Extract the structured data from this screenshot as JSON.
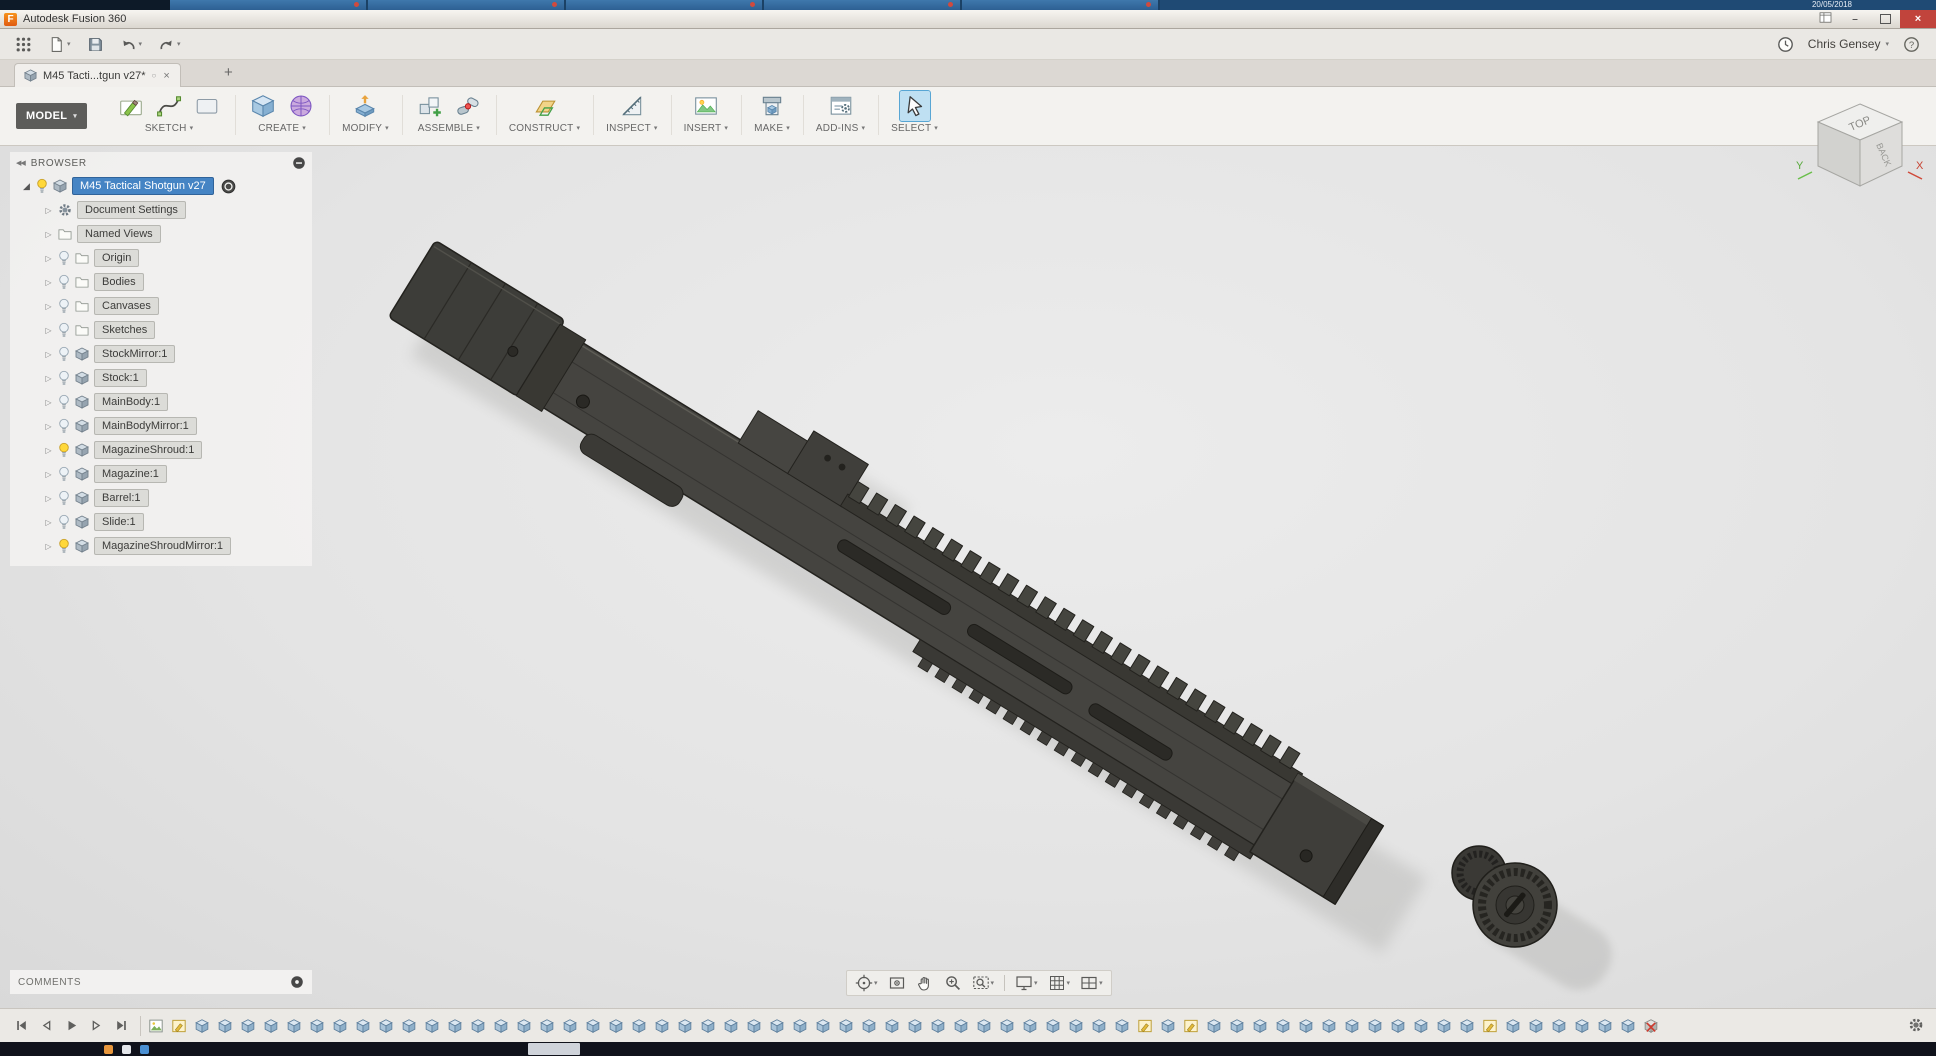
{
  "glyphs": {
    "caret": "▾",
    "plus": "+",
    "close": "×",
    "minimize": "–",
    "status_circle": "○",
    "collapse": "◀◀",
    "expander": "▷",
    "expander_open": "◢"
  },
  "chrome_strip": {
    "tab_count": 5,
    "date": "20/05/2018"
  },
  "titlebar": {
    "app_initial": "F",
    "title": "Autodesk Fusion 360"
  },
  "qat": {
    "buttons": [
      {
        "icon": "app-grid-icon",
        "caret": false
      },
      {
        "icon": "file-icon",
        "caret": true
      },
      {
        "icon": "save-icon",
        "caret": false
      },
      {
        "icon": "undo-icon",
        "caret": true
      },
      {
        "icon": "redo-icon",
        "caret": true
      }
    ],
    "user": "Chris Gensey"
  },
  "doc_tab": {
    "label": "M45 Tacti...tgun v27*"
  },
  "ribbon": {
    "mode_label": "MODEL",
    "groups": [
      {
        "label": "SKETCH",
        "icons": [
          "create-sketch-icon",
          "spline-icon",
          "rectangle-icon"
        ],
        "active": false
      },
      {
        "label": "CREATE",
        "icons": [
          "solid-box-icon",
          "form-sphere-icon"
        ],
        "active": false
      },
      {
        "label": "MODIFY",
        "icons": [
          "press-pull-icon"
        ],
        "active": false
      },
      {
        "label": "ASSEMBLE",
        "icons": [
          "new-component-icon",
          "joint-icon"
        ],
        "active": false
      },
      {
        "label": "CONSTRUCT",
        "icons": [
          "construct-plane-icon"
        ],
        "active": false
      },
      {
        "label": "INSPECT",
        "icons": [
          "measure-icon"
        ],
        "active": false
      },
      {
        "label": "INSERT",
        "icons": [
          "insert-canvas-icon"
        ],
        "active": false
      },
      {
        "label": "MAKE",
        "icons": [
          "make-3dprint-icon"
        ],
        "active": false
      },
      {
        "label": "ADD-INS",
        "icons": [
          "addins-scripts-icon"
        ],
        "active": false
      },
      {
        "label": "SELECT",
        "icons": [
          "select-cursor-icon"
        ],
        "active": true
      }
    ]
  },
  "viewcube": {
    "top_face": "TOP",
    "right_face": "BACK",
    "axis_x": "X",
    "axis_y": "Y"
  },
  "browser": {
    "header": "BROWSER",
    "root": {
      "label": "M45 Tactical Shotgun v27",
      "bulb": "on"
    },
    "items": [
      {
        "label": "Document Settings",
        "icon": "gear",
        "bulb": null
      },
      {
        "label": "Named Views",
        "icon": "folder",
        "bulb": null
      },
      {
        "label": "Origin",
        "icon": "folder",
        "bulb": "off"
      },
      {
        "label": "Bodies",
        "icon": "folder",
        "bulb": "off"
      },
      {
        "label": "Canvases",
        "icon": "folder",
        "bulb": "off"
      },
      {
        "label": "Sketches",
        "icon": "folder",
        "bulb": "off"
      },
      {
        "label": "StockMirror:1",
        "icon": "component",
        "bulb": "off"
      },
      {
        "label": "Stock:1",
        "icon": "component",
        "bulb": "off"
      },
      {
        "label": "MainBody:1",
        "icon": "component",
        "bulb": "off"
      },
      {
        "label": "MainBodyMirror:1",
        "icon": "component",
        "bulb": "off"
      },
      {
        "label": "MagazineShroud:1",
        "icon": "component",
        "bulb": "on"
      },
      {
        "label": "Magazine:1",
        "icon": "component",
        "bulb": "off"
      },
      {
        "label": "Barrel:1",
        "icon": "component",
        "bulb": "off"
      },
      {
        "label": "Slide:1",
        "icon": "component",
        "bulb": "off"
      },
      {
        "label": "MagazineShroudMirror:1",
        "icon": "component",
        "bulb": "on"
      }
    ]
  },
  "comments": {
    "label": "COMMENTS"
  },
  "navbar": {
    "buttons": [
      {
        "icon": "orbit-icon",
        "caret": true,
        "separator_before": false
      },
      {
        "icon": "look-at-icon",
        "caret": false,
        "separator_before": false
      },
      {
        "icon": "pan-icon",
        "caret": false,
        "separator_before": false
      },
      {
        "icon": "zoom-icon",
        "caret": false,
        "separator_before": false
      },
      {
        "icon": "zoom-window-icon",
        "caret": true,
        "separator_before": false
      },
      {
        "icon": "display-settings-icon",
        "caret": true,
        "separator_before": true
      },
      {
        "icon": "grid-settings-icon",
        "caret": true,
        "separator_before": false
      },
      {
        "icon": "viewport-settings-icon",
        "caret": true,
        "separator_before": false
      }
    ]
  },
  "timeline": {
    "playback": [
      "skip-start",
      "step-back",
      "play",
      "step-forward",
      "skip-end"
    ],
    "features": {
      "count": 66,
      "canvas_indices": [
        0
      ],
      "sketch_indices": [
        1,
        43,
        45,
        58
      ],
      "error_indices": [
        65
      ]
    }
  }
}
